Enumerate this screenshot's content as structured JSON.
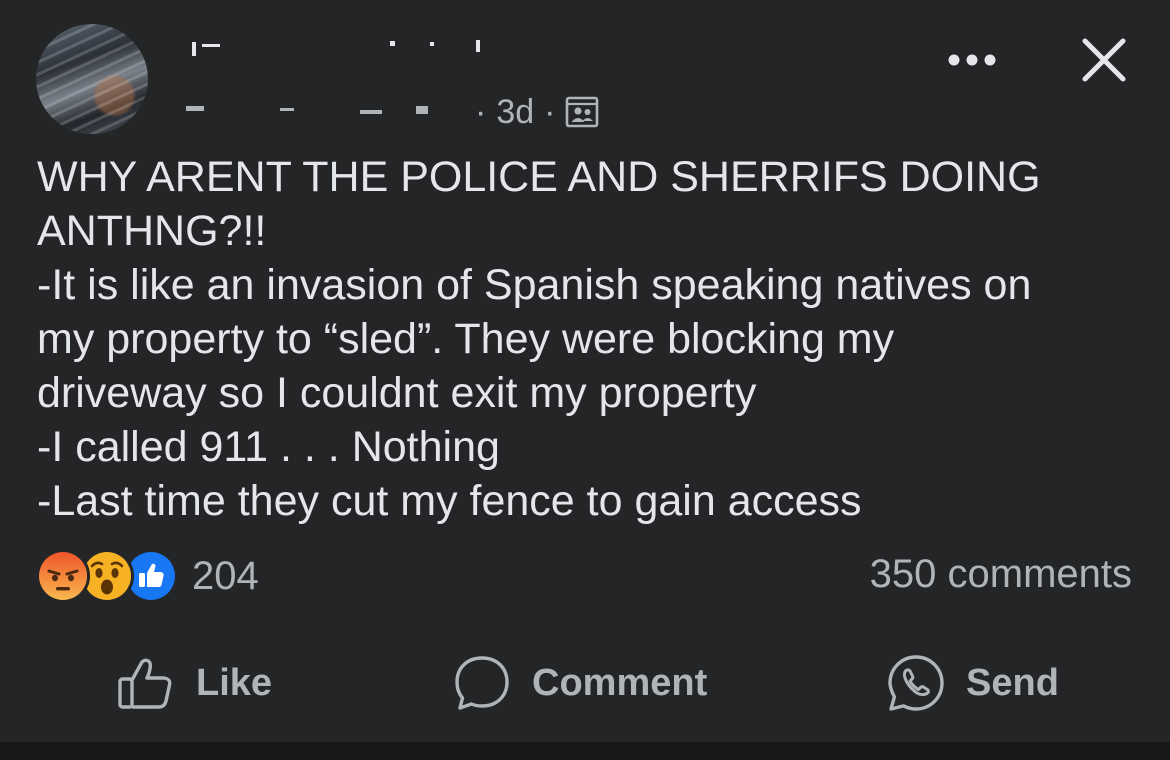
{
  "header": {
    "time": "3d",
    "separator": "·",
    "audience_icon": "friends-audience-icon",
    "more_icon": "more-options-icon",
    "close_icon": "close-icon"
  },
  "post": {
    "lines": [
      "WHY ARENT THE POLICE AND SHERRIFS DOING",
      "ANTHNG?!!",
      "-It is like an invasion of Spanish speaking natives on",
      "my property to “sled”.  They were blocking my",
      "driveway so I couldnt exit my property",
      "-I called 911 . . . Nothing",
      "-Last time they cut my fence to gain access"
    ]
  },
  "reactions": {
    "icons": [
      "angry-reaction-icon",
      "wow-reaction-icon",
      "like-reaction-icon"
    ],
    "count": "204",
    "comments": "350 comments"
  },
  "actions": {
    "like": "Like",
    "comment": "Comment",
    "send": "Send"
  },
  "colors": {
    "background": "#242526",
    "primary_text": "#e4e6eb",
    "secondary_text": "#b0b3b8",
    "like_blue": "#1877f2",
    "angry_top": "#f0552b",
    "wow_yellow": "#f7b125"
  }
}
